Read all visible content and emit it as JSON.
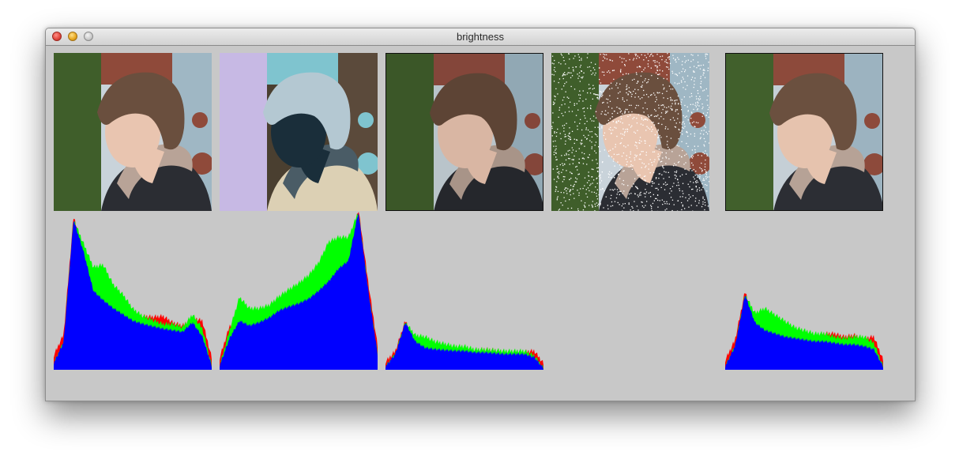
{
  "window": {
    "title": "brightness"
  },
  "panels": [
    {
      "image": "portrait-original",
      "variant": "original",
      "histogram": true
    },
    {
      "image": "portrait-inverted",
      "variant": "inverted",
      "histogram": true
    },
    {
      "image": "portrait-darkened",
      "variant": "darkened",
      "histogram": true
    },
    {
      "image": "portrait-noise",
      "variant": "salt-and-pepper noise",
      "histogram": false
    },
    {
      "image": "portrait-filtered",
      "variant": "filtered",
      "histogram": true
    }
  ],
  "colors": {
    "window_bg": "#c8c8c8",
    "hist_blue": "#0000ff",
    "hist_green": "#00ff00",
    "hist_red": "#ff0000"
  },
  "chart_data": [
    {
      "type": "area",
      "x": [
        0,
        16,
        32,
        48,
        64,
        80,
        96,
        112,
        128,
        144,
        160,
        176,
        192,
        208,
        224,
        240,
        255
      ],
      "series": [
        {
          "color": "#0000ff",
          "values": [
            8,
            35,
            190,
            150,
            100,
            88,
            78,
            70,
            62,
            58,
            55,
            52,
            50,
            48,
            60,
            42,
            5
          ]
        },
        {
          "color": "#00ff00",
          "values": [
            0,
            0,
            0,
            10,
            30,
            45,
            30,
            25,
            15,
            10,
            8,
            6,
            8,
            6,
            10,
            10,
            0
          ]
        },
        {
          "color": "#ff0000",
          "values": [
            10,
            10,
            4,
            4,
            3,
            3,
            5,
            6,
            6,
            10,
            12,
            16,
            10,
            8,
            6,
            20,
            10
          ]
        }
      ]
    },
    {
      "type": "area",
      "x": [
        0,
        16,
        32,
        48,
        64,
        80,
        96,
        112,
        128,
        144,
        160,
        176,
        192,
        208,
        224,
        240,
        255
      ],
      "series": [
        {
          "color": "#0000ff",
          "values": [
            5,
            40,
            62,
            56,
            60,
            66,
            75,
            80,
            84,
            90,
            100,
            112,
            128,
            138,
            200,
            100,
            20
          ]
        },
        {
          "color": "#00ff00",
          "values": [
            0,
            10,
            30,
            22,
            18,
            16,
            18,
            22,
            26,
            30,
            36,
            50,
            40,
            30,
            0,
            0,
            0
          ]
        },
        {
          "color": "#ff0000",
          "values": [
            10,
            15,
            10,
            10,
            10,
            10,
            8,
            8,
            6,
            6,
            4,
            4,
            4,
            4,
            4,
            10,
            10
          ]
        }
      ]
    },
    {
      "type": "area",
      "x": [
        0,
        16,
        32,
        48,
        64,
        80,
        96,
        112,
        128,
        144,
        160,
        176,
        192,
        208,
        224,
        240,
        255
      ],
      "series": [
        {
          "color": "#0000ff",
          "values": [
            4,
            20,
            60,
            36,
            28,
            26,
            25,
            24,
            24,
            22,
            22,
            21,
            20,
            20,
            20,
            16,
            2
          ]
        },
        {
          "color": "#00ff00",
          "values": [
            0,
            0,
            0,
            8,
            14,
            10,
            8,
            6,
            6,
            4,
            4,
            4,
            4,
            4,
            4,
            2,
            0
          ]
        },
        {
          "color": "#ff0000",
          "values": [
            6,
            4,
            2,
            2,
            2,
            2,
            3,
            3,
            3,
            3,
            4,
            4,
            3,
            3,
            3,
            8,
            6
          ]
        }
      ]
    },
    {
      "type": "area",
      "x": [
        0,
        16,
        32,
        48,
        64,
        80,
        96,
        112,
        128,
        144,
        160,
        176,
        192,
        208,
        224,
        240,
        255
      ],
      "series": [
        {
          "color": "#0000ff",
          "values": [
            4,
            30,
            95,
            60,
            50,
            46,
            42,
            40,
            38,
            36,
            36,
            34,
            32,
            32,
            30,
            26,
            4
          ]
        },
        {
          "color": "#00ff00",
          "values": [
            0,
            0,
            0,
            12,
            28,
            24,
            20,
            14,
            12,
            10,
            10,
            8,
            8,
            10,
            12,
            8,
            0
          ]
        },
        {
          "color": "#ff0000",
          "values": [
            8,
            8,
            4,
            4,
            4,
            4,
            5,
            5,
            6,
            8,
            10,
            12,
            10,
            12,
            10,
            16,
            8
          ]
        }
      ]
    }
  ]
}
